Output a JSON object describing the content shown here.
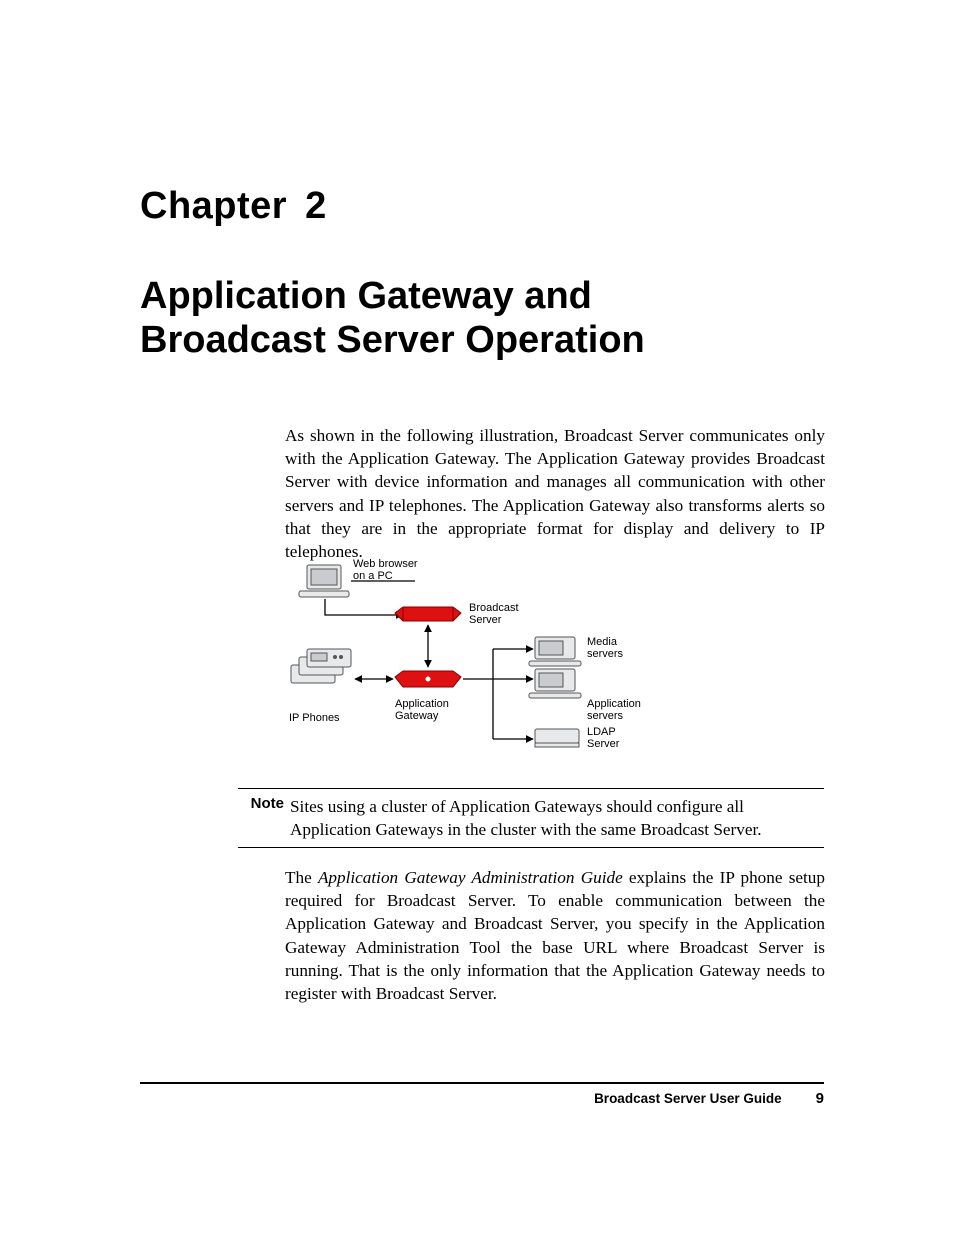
{
  "chapter": {
    "label": "Chapter",
    "number": "2"
  },
  "title_line1": "Application Gateway and",
  "title_line2": "Broadcast Server Operation",
  "para1": "As shown in the following illustration, Broadcast Server communicates only with the Application Gateway. The Application Gateway provides Broadcast Server with device information and manages all communication with other servers and IP telephones. The Application Gateway also transforms alerts so that they are in the appropriate format for display and delivery to IP telephones.",
  "figure": {
    "pc_line1": "Web browser",
    "pc_line2": "on a PC",
    "broadcast_line1": "Broadcast",
    "broadcast_line2": "Server",
    "media_line1": "Media",
    "media_line2": "servers",
    "app_gateway_line1": "Application",
    "app_gateway_line2": "Gateway",
    "app_servers_line1": "Application",
    "app_servers_line2": "servers",
    "ipphones": "IP Phones",
    "ldap_line1": "LDAP",
    "ldap_line2": "Server"
  },
  "note": {
    "label": "Note",
    "text": "Sites using a cluster of Application Gateways should configure all Application Gateways in the cluster with the same Broadcast Server."
  },
  "para2_pre": "The ",
  "para2_title": "Application Gateway Administration Guide",
  "para2_post": " explains the IP phone setup required for Broadcast Server. To enable communication between the Application Gateway and Broadcast Server, you specify in the Application Gateway Administration Tool the base URL where Broadcast Server is running. That is the only information that the Application Gateway needs to register with Broadcast Server.",
  "footer": {
    "title": "Broadcast Server User Guide",
    "page": "9"
  }
}
